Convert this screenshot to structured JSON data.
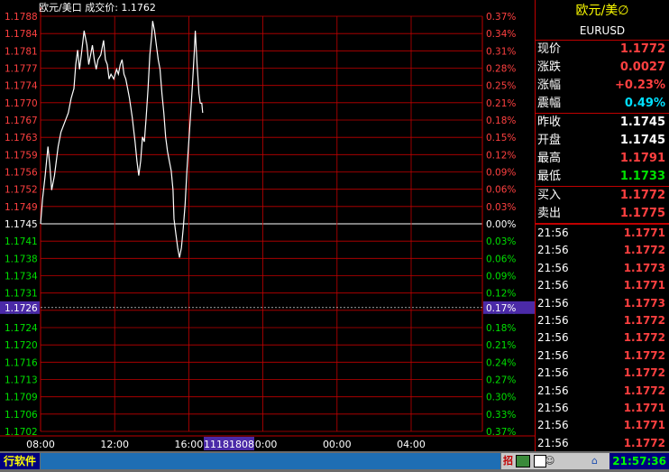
{
  "chart": {
    "header": "欧元/美口 成交价: 1.1762",
    "y_ticks": [
      "1.1788",
      "1.1784",
      "1.1781",
      "1.1777",
      "1.1774",
      "1.1770",
      "1.1767",
      "1.1763",
      "1.1759",
      "1.1756",
      "1.1752",
      "1.1749",
      "1.1745",
      "1.1741",
      "1.1738",
      "1.1734",
      "1.1731",
      "1.1727",
      "1.1724",
      "1.1720",
      "1.1716",
      "1.1713",
      "1.1709",
      "1.1706",
      "1.1702"
    ],
    "pct_ticks": [
      "0.37%",
      "0.34%",
      "0.31%",
      "0.28%",
      "0.25%",
      "0.21%",
      "0.18%",
      "0.15%",
      "0.12%",
      "0.09%",
      "0.06%",
      "0.03%",
      "0.00%",
      "0.03%",
      "0.06%",
      "0.09%",
      "0.12%",
      "0.15%",
      "0.18%",
      "0.21%",
      "0.24%",
      "0.27%",
      "0.30%",
      "0.33%",
      "0.37%"
    ],
    "x_ticks": [
      "08:00",
      "12:00",
      "16:00",
      "20:00",
      "00:00",
      "04:00"
    ],
    "cursor": {
      "price": "1.1726",
      "pct": "0.17%",
      "time": "11181808"
    },
    "colors": {
      "up": "#ff4040",
      "down": "#00e000",
      "base": "#ffffff",
      "grid": "#c00000",
      "price_line": "#ffffff",
      "cursor_bg": "#4b2aa8"
    }
  },
  "chart_data": {
    "type": "line",
    "title": "欧元/美口 成交价: 1.1762",
    "xlabel": "",
    "ylabel": "",
    "ylim": [
      1.1702,
      1.1788
    ],
    "base": 1.1745,
    "xlim": [
      "08:00",
      "06:00"
    ],
    "x_ticks": [
      "08:00",
      "12:00",
      "16:00",
      "20:00",
      "00:00",
      "04:00"
    ],
    "series": [
      {
        "values": [
          [
            0,
            1.1745
          ],
          [
            0.1,
            1.175
          ],
          [
            0.25,
            1.1755
          ],
          [
            0.4,
            1.1761
          ],
          [
            0.5,
            1.1757
          ],
          [
            0.6,
            1.1752
          ],
          [
            0.75,
            1.1755
          ],
          [
            0.95,
            1.1761
          ],
          [
            1.1,
            1.1764
          ],
          [
            1.3,
            1.1766
          ],
          [
            1.5,
            1.1768
          ],
          [
            1.65,
            1.1771
          ],
          [
            1.8,
            1.1773
          ],
          [
            1.9,
            1.1778
          ],
          [
            2.0,
            1.1781
          ],
          [
            2.1,
            1.1777
          ],
          [
            2.2,
            1.178
          ],
          [
            2.35,
            1.1785
          ],
          [
            2.5,
            1.1782
          ],
          [
            2.6,
            1.1778
          ],
          [
            2.7,
            1.178
          ],
          [
            2.8,
            1.1782
          ],
          [
            2.9,
            1.1779
          ],
          [
            3.0,
            1.1777
          ],
          [
            3.1,
            1.1779
          ],
          [
            3.25,
            1.178
          ],
          [
            3.4,
            1.1783
          ],
          [
            3.5,
            1.1779
          ],
          [
            3.6,
            1.1778
          ],
          [
            3.7,
            1.1775
          ],
          [
            3.8,
            1.1776
          ],
          [
            3.95,
            1.1775
          ],
          [
            4.1,
            1.1777
          ],
          [
            4.2,
            1.1776
          ],
          [
            4.3,
            1.1778
          ],
          [
            4.4,
            1.1779
          ],
          [
            4.5,
            1.1776
          ],
          [
            4.6,
            1.1775
          ],
          [
            4.7,
            1.1773
          ],
          [
            4.8,
            1.1771
          ],
          [
            4.95,
            1.1767
          ],
          [
            5.1,
            1.1762
          ],
          [
            5.2,
            1.1758
          ],
          [
            5.3,
            1.1755
          ],
          [
            5.4,
            1.1758
          ],
          [
            5.5,
            1.1763
          ],
          [
            5.6,
            1.1762
          ],
          [
            5.7,
            1.1767
          ],
          [
            5.8,
            1.1773
          ],
          [
            5.9,
            1.178
          ],
          [
            6.0,
            1.1784
          ],
          [
            6.05,
            1.1787
          ],
          [
            6.15,
            1.1785
          ],
          [
            6.25,
            1.1782
          ],
          [
            6.35,
            1.1779
          ],
          [
            6.45,
            1.1777
          ],
          [
            6.55,
            1.1772
          ],
          [
            6.65,
            1.1768
          ],
          [
            6.75,
            1.1763
          ],
          [
            6.85,
            1.176
          ],
          [
            6.95,
            1.1758
          ],
          [
            7.05,
            1.1756
          ],
          [
            7.15,
            1.1752
          ],
          [
            7.2,
            1.1746
          ],
          [
            7.3,
            1.1743
          ],
          [
            7.4,
            1.174
          ],
          [
            7.5,
            1.1738
          ],
          [
            7.6,
            1.174
          ],
          [
            7.7,
            1.1744
          ],
          [
            7.8,
            1.1749
          ],
          [
            7.9,
            1.1756
          ],
          [
            8.0,
            1.1762
          ],
          [
            8.1,
            1.1768
          ],
          [
            8.2,
            1.1774
          ],
          [
            8.3,
            1.1781
          ],
          [
            8.35,
            1.1785
          ],
          [
            8.45,
            1.1778
          ],
          [
            8.55,
            1.1772
          ],
          [
            8.62,
            1.177
          ],
          [
            8.7,
            1.177
          ],
          [
            8.75,
            1.1768
          ]
        ]
      }
    ]
  },
  "sidebar": {
    "title": "欧元/美∅",
    "code": "EURUSD",
    "quotes": [
      {
        "label": "现价",
        "value": "1.1772",
        "color": "#ff4040"
      },
      {
        "label": "涨跌",
        "value": "0.0027",
        "color": "#ff4040"
      },
      {
        "label": "涨幅",
        "value": "+0.23%",
        "color": "#ff4040"
      },
      {
        "label": "震幅",
        "value": "0.49%",
        "color": "#00e0ff"
      },
      {
        "label": "昨收",
        "value": "1.1745",
        "color": "#ffffff"
      },
      {
        "label": "开盘",
        "value": "1.1745",
        "color": "#ffffff"
      },
      {
        "label": "最高",
        "value": "1.1791",
        "color": "#ff4040"
      },
      {
        "label": "最低",
        "value": "1.1733",
        "color": "#00e000"
      },
      {
        "label": "买入",
        "value": "1.1772",
        "color": "#ff4040"
      },
      {
        "label": "卖出",
        "value": "1.1775",
        "color": "#ff4040"
      }
    ],
    "ticks": [
      {
        "time": "21:56",
        "price": "1.1771"
      },
      {
        "time": "21:56",
        "price": "1.1772"
      },
      {
        "time": "21:56",
        "price": "1.1773"
      },
      {
        "time": "21:56",
        "price": "1.1771"
      },
      {
        "time": "21:56",
        "price": "1.1773"
      },
      {
        "time": "21:56",
        "price": "1.1772"
      },
      {
        "time": "21:56",
        "price": "1.1772"
      },
      {
        "time": "21:56",
        "price": "1.1772"
      },
      {
        "time": "21:56",
        "price": "1.1772"
      },
      {
        "time": "21:56",
        "price": "1.1772"
      },
      {
        "time": "21:56",
        "price": "1.1771"
      },
      {
        "time": "21:56",
        "price": "1.1771"
      },
      {
        "time": "21:56",
        "price": "1.1772"
      }
    ]
  },
  "statusbar": {
    "brand": "行软件",
    "tool_label": "招",
    "clock": "21:57:36"
  }
}
